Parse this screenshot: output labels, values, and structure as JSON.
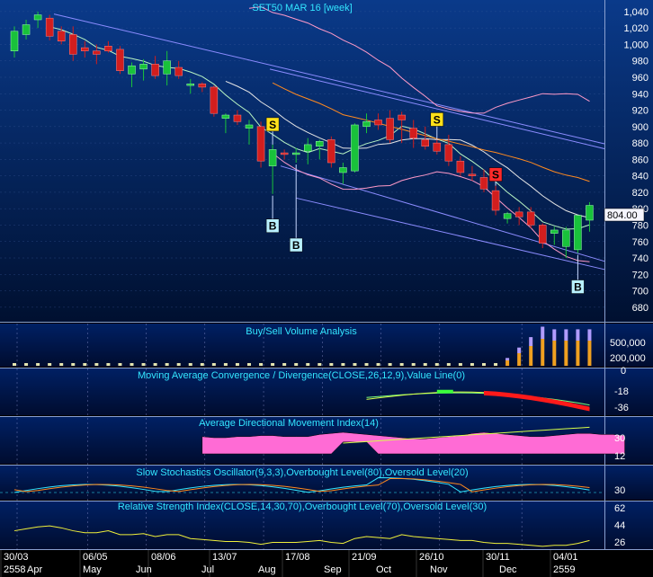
{
  "colors": {
    "bg": "#062a6e",
    "bg_dark": "#00113a",
    "grid": "#3a5a9a",
    "text": "#ffffff",
    "cyan_text": "#33e6ff",
    "up": "#19c23b",
    "down": "#d21e1e",
    "ma_fast": "#b9f5c3",
    "ma_slow": "#ff8a1f",
    "ma_long": "#e5e5e5",
    "bb": "#ff9ac8",
    "channel": "#8c8cff",
    "sell_marker": "#ffe11a",
    "sell_marker_red": "#ff2a2a",
    "buy_marker": "#b8f1ff",
    "adx_fill": "#ff6bd5",
    "price_tag": "#f5f5ff"
  },
  "main": {
    "title": "SET50 MAR 16   [week]",
    "price_tag": "804.00",
    "y_ticks": [
      "1,040",
      "1,020",
      "1,000",
      "980",
      "960",
      "940",
      "920",
      "900",
      "880",
      "860",
      "840",
      "820",
      "800",
      "780",
      "760",
      "740",
      "720",
      "700",
      "680"
    ],
    "markers": [
      {
        "label": "S",
        "type": "sell",
        "week": 22
      },
      {
        "label": "B",
        "type": "buy",
        "week": 22
      },
      {
        "label": "B",
        "type": "buy",
        "week": 24
      },
      {
        "label": "S",
        "type": "sell",
        "week": 36
      },
      {
        "label": "S",
        "type": "sell_red",
        "week": 41
      },
      {
        "label": "B",
        "type": "buy",
        "week": 48
      }
    ]
  },
  "volume_panel": {
    "title": "Buy/Sell Volume Analysis",
    "ticks": [
      "500,000",
      "200,000",
      "0"
    ]
  },
  "macd_panel": {
    "title": "Moving Average Convergence / Divergence(CLOSE,26,12,9),Value Line(0)",
    "ticks": [
      "-18",
      "-36"
    ]
  },
  "adx_panel": {
    "title": "Average Directional Movement Index(14)",
    "ticks": [
      "30",
      "12"
    ]
  },
  "stoch_panel": {
    "title": "Slow Stochastics Oscillator(9,3,3),Overbought Level(80),Oversold Level(20)",
    "ticks": [
      "30"
    ]
  },
  "rsi_panel": {
    "title": "Relative Strength Index(CLOSE,14,30,70),Overbought Level(70),Oversold Level(30)",
    "ticks": [
      "62",
      "44",
      "26"
    ]
  },
  "x_axis": {
    "top_labels": [
      "30/03",
      "06/05",
      "08/06",
      "13/07",
      "17/08",
      "21/09",
      "26/10",
      "30/11",
      "04/01"
    ],
    "bottom_labels": [
      "2558",
      "Apr",
      "May",
      "Jun",
      "Jul",
      "Aug",
      "Sep",
      "Oct",
      "Nov",
      "Dec",
      "2559"
    ]
  },
  "chart_data": {
    "type": "candlestick",
    "title": "SET50 MAR 16   [week]",
    "ylim": [
      670,
      1045
    ],
    "candles": [
      {
        "o": 992,
        "h": 1022,
        "l": 984,
        "c": 1016
      },
      {
        "o": 1012,
        "h": 1030,
        "l": 1006,
        "c": 1024
      },
      {
        "o": 1030,
        "h": 1040,
        "l": 1020,
        "c": 1036
      },
      {
        "o": 1032,
        "h": 1036,
        "l": 1005,
        "c": 1010
      },
      {
        "o": 1016,
        "h": 1022,
        "l": 1000,
        "c": 1004
      },
      {
        "o": 1012,
        "h": 1022,
        "l": 980,
        "c": 988
      },
      {
        "o": 996,
        "h": 1004,
        "l": 984,
        "c": 992
      },
      {
        "o": 992,
        "h": 1000,
        "l": 976,
        "c": 988
      },
      {
        "o": 998,
        "h": 1004,
        "l": 990,
        "c": 992
      },
      {
        "o": 994,
        "h": 998,
        "l": 964,
        "c": 968
      },
      {
        "o": 964,
        "h": 978,
        "l": 948,
        "c": 974
      },
      {
        "o": 970,
        "h": 982,
        "l": 956,
        "c": 976
      },
      {
        "o": 976,
        "h": 986,
        "l": 958,
        "c": 962
      },
      {
        "o": 964,
        "h": 992,
        "l": 950,
        "c": 980
      },
      {
        "o": 972,
        "h": 980,
        "l": 958,
        "c": 962
      },
      {
        "o": 950,
        "h": 958,
        "l": 940,
        "c": 952
      },
      {
        "o": 952,
        "h": 954,
        "l": 942,
        "c": 948
      },
      {
        "o": 948,
        "h": 950,
        "l": 912,
        "c": 916
      },
      {
        "o": 910,
        "h": 916,
        "l": 892,
        "c": 914
      },
      {
        "o": 914,
        "h": 920,
        "l": 902,
        "c": 906
      },
      {
        "o": 898,
        "h": 908,
        "l": 878,
        "c": 902
      },
      {
        "o": 900,
        "h": 906,
        "l": 850,
        "c": 858
      },
      {
        "o": 852,
        "h": 878,
        "l": 818,
        "c": 872
      },
      {
        "o": 868,
        "h": 872,
        "l": 860,
        "c": 866
      },
      {
        "o": 866,
        "h": 874,
        "l": 856,
        "c": 868
      },
      {
        "o": 870,
        "h": 886,
        "l": 854,
        "c": 878
      },
      {
        "o": 876,
        "h": 884,
        "l": 860,
        "c": 882
      },
      {
        "o": 884,
        "h": 888,
        "l": 850,
        "c": 856
      },
      {
        "o": 844,
        "h": 856,
        "l": 830,
        "c": 850
      },
      {
        "o": 846,
        "h": 904,
        "l": 844,
        "c": 902
      },
      {
        "o": 900,
        "h": 916,
        "l": 892,
        "c": 906
      },
      {
        "o": 908,
        "h": 916,
        "l": 896,
        "c": 902
      },
      {
        "o": 910,
        "h": 920,
        "l": 880,
        "c": 884
      },
      {
        "o": 914,
        "h": 918,
        "l": 880,
        "c": 908
      },
      {
        "o": 898,
        "h": 908,
        "l": 874,
        "c": 886
      },
      {
        "o": 884,
        "h": 900,
        "l": 872,
        "c": 876
      },
      {
        "o": 880,
        "h": 884,
        "l": 866,
        "c": 870
      },
      {
        "o": 878,
        "h": 890,
        "l": 852,
        "c": 858
      },
      {
        "o": 858,
        "h": 864,
        "l": 840,
        "c": 844
      },
      {
        "o": 842,
        "h": 852,
        "l": 834,
        "c": 840
      },
      {
        "o": 838,
        "h": 848,
        "l": 820,
        "c": 824
      },
      {
        "o": 822,
        "h": 828,
        "l": 792,
        "c": 798
      },
      {
        "o": 788,
        "h": 796,
        "l": 782,
        "c": 794
      },
      {
        "o": 796,
        "h": 802,
        "l": 780,
        "c": 790
      },
      {
        "o": 796,
        "h": 802,
        "l": 776,
        "c": 780
      },
      {
        "o": 780,
        "h": 782,
        "l": 752,
        "c": 758
      },
      {
        "o": 770,
        "h": 778,
        "l": 756,
        "c": 774
      },
      {
        "o": 754,
        "h": 778,
        "l": 740,
        "c": 774
      },
      {
        "o": 750,
        "h": 790,
        "l": 746,
        "c": 792
      },
      {
        "o": 786,
        "h": 808,
        "l": 772,
        "c": 804
      }
    ]
  }
}
